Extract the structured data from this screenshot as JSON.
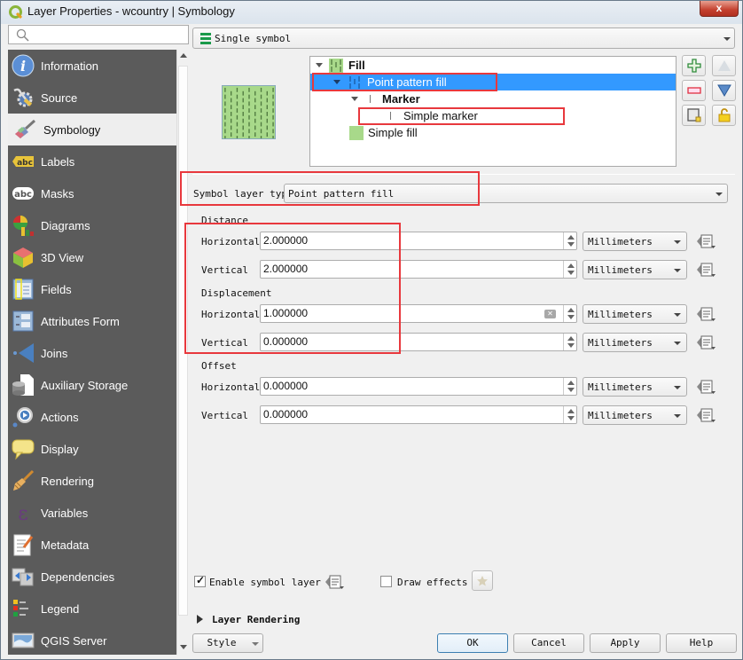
{
  "window": {
    "title": "Layer Properties - wcountry | Symbology",
    "close_label": "x"
  },
  "search": {
    "placeholder": "",
    "value": ""
  },
  "sidebar": {
    "items": [
      {
        "label": "Information",
        "icon": "info-icon"
      },
      {
        "label": "Source",
        "icon": "source-icon"
      },
      {
        "label": "Symbology",
        "icon": "symbology-brush-icon",
        "active": true
      },
      {
        "label": "Labels",
        "icon": "labels-abc-icon"
      },
      {
        "label": "Masks",
        "icon": "masks-abc-icon"
      },
      {
        "label": "Diagrams",
        "icon": "diagrams-icon"
      },
      {
        "label": "3D View",
        "icon": "3d-view-icon"
      },
      {
        "label": "Fields",
        "icon": "fields-icon"
      },
      {
        "label": "Attributes Form",
        "icon": "attributes-form-icon"
      },
      {
        "label": "Joins",
        "icon": "joins-icon"
      },
      {
        "label": "Auxiliary Storage",
        "icon": "auxiliary-storage-icon"
      },
      {
        "label": "Actions",
        "icon": "actions-icon"
      },
      {
        "label": "Display",
        "icon": "display-icon"
      },
      {
        "label": "Rendering",
        "icon": "rendering-icon"
      },
      {
        "label": "Variables",
        "icon": "variables-icon"
      },
      {
        "label": "Metadata",
        "icon": "metadata-icon"
      },
      {
        "label": "Dependencies",
        "icon": "dependencies-icon"
      },
      {
        "label": "Legend",
        "icon": "legend-icon"
      },
      {
        "label": "QGIS Server",
        "icon": "qgis-server-icon"
      }
    ]
  },
  "renderer": {
    "selected": "Single symbol"
  },
  "symbol_tree": {
    "rows": [
      {
        "label": "Fill",
        "bold": true,
        "expanded": true
      },
      {
        "label": "Point pattern fill",
        "selected": true,
        "expanded": true
      },
      {
        "label": "Marker",
        "bold": true,
        "expanded": true
      },
      {
        "label": "Simple marker"
      },
      {
        "label": "Simple fill"
      }
    ]
  },
  "tree_buttons": {
    "add": "add-symbol-layer",
    "remove": "remove-symbol-layer",
    "up": "move-up",
    "down": "move-down",
    "duplicate": "duplicate-symbol-layer",
    "lock": "lock-layer-color"
  },
  "symbol_layer_type": {
    "label": "Symbol layer type",
    "selected": "Point pattern fill"
  },
  "distance": {
    "heading": "Distance",
    "horizontal": {
      "label": "Horizontal",
      "value": "2.000000",
      "unit": "Millimeters"
    },
    "vertical": {
      "label": "Vertical",
      "value": "2.000000",
      "unit": "Millimeters"
    }
  },
  "displacement": {
    "heading": "Displacement",
    "horizontal": {
      "label": "Horizontal",
      "value": "1.000000",
      "unit": "Millimeters"
    },
    "vertical": {
      "label": "Vertical",
      "value": "0.000000",
      "unit": "Millimeters"
    }
  },
  "offset": {
    "heading": "Offset",
    "horizontal": {
      "label": "Horizontal",
      "value": "0.000000",
      "unit": "Millimeters"
    },
    "vertical": {
      "label": "Vertical",
      "value": "0.000000",
      "unit": "Millimeters"
    }
  },
  "options": {
    "enable_symbol_layer": {
      "label": "Enable symbol layer",
      "checked": true
    },
    "draw_effects": {
      "label": "Draw effects",
      "checked": false
    }
  },
  "layer_rendering": {
    "label": "Layer Rendering"
  },
  "footer": {
    "style_label": "Style",
    "ok_label": "OK",
    "cancel_label": "Cancel",
    "apply_label": "Apply",
    "help_label": "Help"
  },
  "colors": {
    "selection": "#3399ff",
    "sidebar_bg": "#5b5b5b",
    "highlight_box": "#e8383d",
    "pattern_fill": "#a8d98a",
    "pattern_marker": "#4f7a3f"
  }
}
